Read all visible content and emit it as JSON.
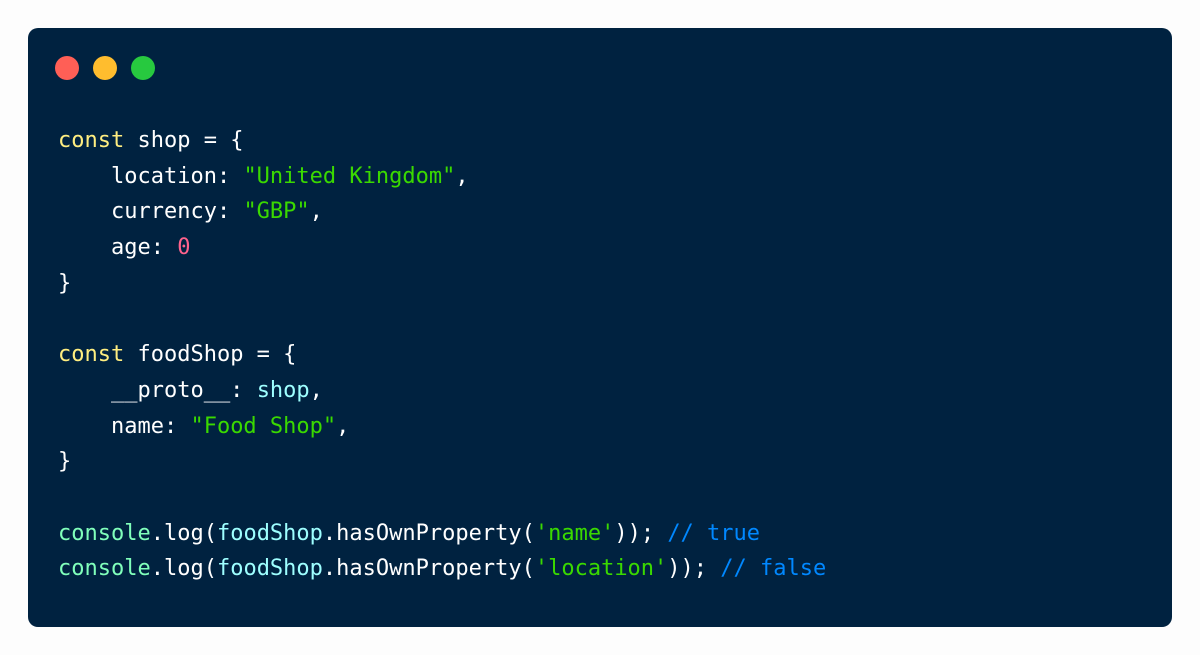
{
  "window": {
    "buttons": {
      "close": "red",
      "minimize": "yellow",
      "zoom": "green"
    },
    "colors": {
      "background": "#002240",
      "keyword": "#ffee80",
      "string": "#3ad900",
      "number": "#ff628c",
      "builtin": "#80ffbb",
      "reference": "#9effff",
      "comment": "#0088ff"
    }
  },
  "code": {
    "lines": [
      [
        {
          "t": "const",
          "c": "kw"
        },
        {
          "t": " shop = {",
          "c": "id"
        }
      ],
      [
        {
          "t": "    location: ",
          "c": "id"
        },
        {
          "t": "\"United Kingdom\"",
          "c": "str"
        },
        {
          "t": ",",
          "c": "punc"
        }
      ],
      [
        {
          "t": "    currency: ",
          "c": "id"
        },
        {
          "t": "\"GBP\"",
          "c": "str"
        },
        {
          "t": ",",
          "c": "punc"
        }
      ],
      [
        {
          "t": "    age: ",
          "c": "id"
        },
        {
          "t": "0",
          "c": "num"
        }
      ],
      [
        {
          "t": "}",
          "c": "punc"
        }
      ],
      [],
      [
        {
          "t": "const",
          "c": "kw"
        },
        {
          "t": " foodShop = {",
          "c": "id"
        }
      ],
      [
        {
          "t": "    __proto__: ",
          "c": "id"
        },
        {
          "t": "shop",
          "c": "ref"
        },
        {
          "t": ",",
          "c": "punc"
        }
      ],
      [
        {
          "t": "    name: ",
          "c": "id"
        },
        {
          "t": "\"Food Shop\"",
          "c": "str"
        },
        {
          "t": ",",
          "c": "punc"
        }
      ],
      [
        {
          "t": "}",
          "c": "punc"
        }
      ],
      [],
      [
        {
          "t": "console",
          "c": "obj"
        },
        {
          "t": ".log(",
          "c": "punc"
        },
        {
          "t": "foodShop",
          "c": "ref"
        },
        {
          "t": ".hasOwnProperty(",
          "c": "punc"
        },
        {
          "t": "'name'",
          "c": "str"
        },
        {
          "t": ")); ",
          "c": "punc"
        },
        {
          "t": "// true",
          "c": "com"
        }
      ],
      [
        {
          "t": "console",
          "c": "obj"
        },
        {
          "t": ".log(",
          "c": "punc"
        },
        {
          "t": "foodShop",
          "c": "ref"
        },
        {
          "t": ".hasOwnProperty(",
          "c": "punc"
        },
        {
          "t": "'location'",
          "c": "str"
        },
        {
          "t": ")); ",
          "c": "punc"
        },
        {
          "t": "// false",
          "c": "com"
        }
      ]
    ]
  }
}
